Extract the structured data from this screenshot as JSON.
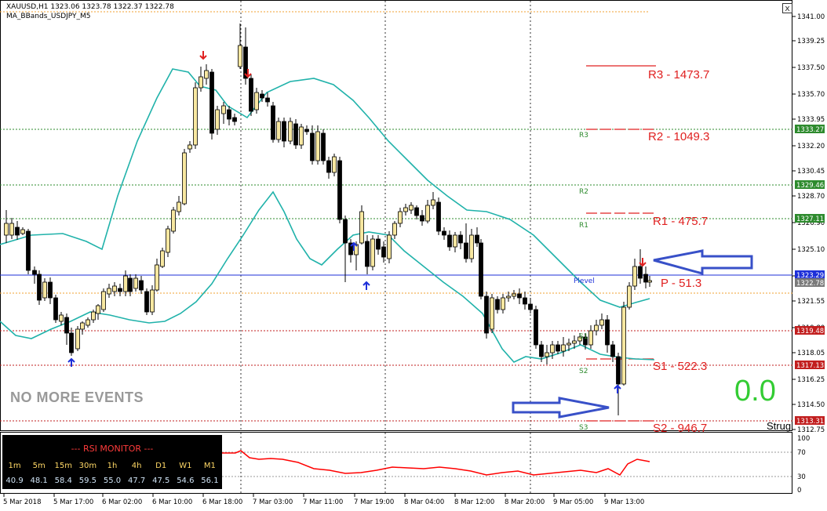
{
  "header": {
    "symbol_line": "XAUUSD,H1  1323.06 1323.78 1322.37 1322.78",
    "indicator_name": "MA_BBands_USDJPY_M5"
  },
  "close_button": "x",
  "price_axis": {
    "ticks": [
      "1341.00",
      "1339.25",
      "1337.50",
      "1335.70",
      "1333.95",
      "1332.20",
      "1330.45",
      "1328.70",
      "1326.90",
      "1325.10",
      "1323.35",
      "1321.55",
      "1319.80",
      "1318.05",
      "1316.25",
      "1314.50",
      "1312.75"
    ],
    "badges": [
      {
        "label": "1333.27",
        "color": "#2e8b2e"
      },
      {
        "label": "1329.46",
        "color": "#2e8b2e"
      },
      {
        "label": "1327.11",
        "color": "#2e8b2e"
      },
      {
        "label": "1323.29",
        "color": "#1d2fd9"
      },
      {
        "label": "1322.78",
        "color": "#7a7a7a"
      },
      {
        "label": "1319.48",
        "color": "#c21f1f"
      },
      {
        "label": "1317.13",
        "color": "#c21f1f"
      },
      {
        "label": "1313.31",
        "color": "#c21f1f"
      }
    ]
  },
  "time_axis": [
    "5 Mar 2018",
    "5 Mar 17:00",
    "6 Mar 02:00",
    "6 Mar 10:00",
    "6 Mar 18:00",
    "7 Mar 03:00",
    "7 Mar 11:00",
    "7 Mar 19:00",
    "8 Mar 04:00",
    "8 Mar 12:00",
    "8 Mar 20:00",
    "9 Mar 05:00",
    "9 Mar 13:00"
  ],
  "pivots": {
    "small_labels": [
      "R3",
      "R2",
      "R1",
      "Plevel",
      "S1",
      "S2",
      "S3"
    ],
    "big_labels": [
      "R3 - 1473.7",
      "R2 - 1049.3",
      "R1 - 475.7",
      "P - 51.3",
      "S1 - 522.3",
      "S2 - 946.7"
    ]
  },
  "rsi_axis": {
    "ticks": [
      "100",
      "70",
      "30",
      "0"
    ]
  },
  "rsi_monitor": {
    "title": "--- RSI MONITOR ---",
    "timeframes": [
      "1m",
      "5m",
      "15m",
      "30m",
      "1h",
      "4h",
      "D1",
      "W1",
      "M1"
    ],
    "values": [
      "40.9",
      "48.1",
      "58.4",
      "59.5",
      "55.0",
      "47.7",
      "47.5",
      "54.6",
      "56.1"
    ]
  },
  "status_text": "NO MORE EVENTS",
  "score_value": "0.0",
  "corner_text": "Strug",
  "colors": {
    "bull": "#f7e7a0",
    "bear": "#000000",
    "band": "#20b2aa",
    "pivot_red": "#e02020",
    "pivot_green": "#2e8b2e",
    "pivot_blue": "#1d2fd9",
    "rsi_line": "#ff0000",
    "arrow_blue": "#3850c8"
  }
}
